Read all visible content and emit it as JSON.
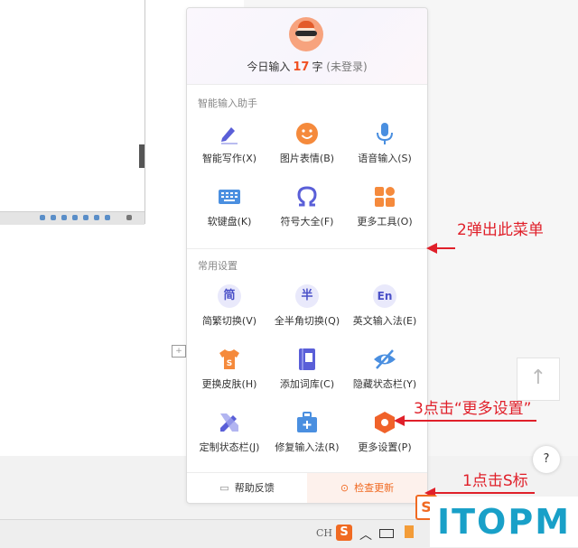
{
  "panel": {
    "today": {
      "prefix": "今日输入",
      "count": "17",
      "unit": "字",
      "status": "(未登录)"
    },
    "sections": [
      {
        "title": "智能输入助手",
        "items": [
          {
            "label": "智能写作(X)",
            "icon": "pen-icon"
          },
          {
            "label": "图片表情(B)",
            "icon": "smiley-icon"
          },
          {
            "label": "语音输入(S)",
            "icon": "microphone-icon"
          },
          {
            "label": "软键盘(K)",
            "icon": "keyboard-icon"
          },
          {
            "label": "符号大全(F)",
            "icon": "omega-icon"
          },
          {
            "label": "更多工具(O)",
            "icon": "grid-icon"
          }
        ]
      },
      {
        "title": "常用设置",
        "items": [
          {
            "label": "简繁切换(V)",
            "icon": "simplified-icon",
            "glyph": "简"
          },
          {
            "label": "全半角切换(Q)",
            "icon": "halfwidth-icon",
            "glyph": "半"
          },
          {
            "label": "英文输入法(E)",
            "icon": "english-icon",
            "glyph": "En"
          },
          {
            "label": "更换皮肤(H)",
            "icon": "skin-shirt-icon"
          },
          {
            "label": "添加词库(C)",
            "icon": "dictionary-icon"
          },
          {
            "label": "隐藏状态栏(Y)",
            "icon": "eye-hide-icon"
          },
          {
            "label": "定制状态栏(J)",
            "icon": "pencil-ruler-icon"
          },
          {
            "label": "修复输入法(R)",
            "icon": "toolbox-icon"
          },
          {
            "label": "更多设置(P)",
            "icon": "hexagon-settings-icon"
          }
        ]
      }
    ],
    "footer": {
      "feedback": "帮助反馈",
      "check_update": "检查更新"
    }
  },
  "annotations": {
    "step2": "2弹出此菜单",
    "step3": "3点击“更多设置”",
    "step1": "1点击S标"
  },
  "taskbar": {
    "ime_label": "CH",
    "s_logo": "S"
  },
  "watermark": "ITOPM",
  "colors": {
    "accent": "#f06a22",
    "annotation": "#e0202a",
    "icon_purple": "#5a5fd8",
    "watermark": "#19a0c8"
  }
}
